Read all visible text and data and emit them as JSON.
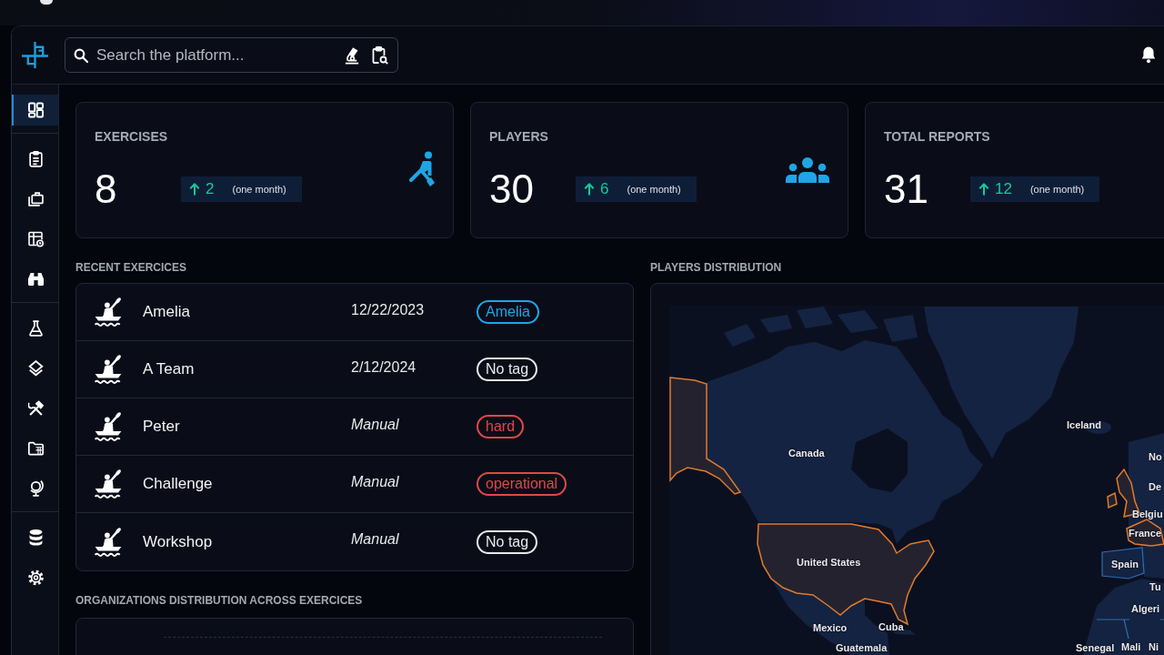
{
  "top_bar": {
    "search": {
      "placeholder": "Search the platform..."
    }
  },
  "sidebar": {
    "sections": [
      {
        "items": [
          {
            "selected": true
          }
        ]
      },
      {
        "items": [
          {
            "selected": false
          },
          {
            "selected": false
          },
          {
            "selected": false
          },
          {
            "selected": false
          }
        ]
      },
      {
        "items": [
          {
            "selected": false
          },
          {
            "selected": false
          },
          {
            "selected": false
          },
          {
            "selected": false
          },
          {
            "selected": false
          }
        ]
      },
      {
        "items": [
          {
            "selected": false
          },
          {
            "selected": false
          }
        ]
      }
    ]
  },
  "stats": [
    {
      "label": "EXERCISES",
      "value": "8",
      "change": "2",
      "period": "(one month)"
    },
    {
      "label": "PLAYERS",
      "value": "30",
      "change": "6",
      "period": "(one month)"
    },
    {
      "label": "TOTAL REPORTS",
      "value": "31",
      "change": "12",
      "period": "(one month)"
    }
  ],
  "recent_exercises": {
    "title": "RECENT EXERCICES",
    "rows": [
      {
        "name": "Amelia",
        "start": {
          "kind": "date",
          "text": "12/22/2023"
        },
        "tag": {
          "label": "Amelia",
          "color": "#1fa5e6"
        }
      },
      {
        "name": "A Team",
        "start": {
          "kind": "date",
          "text": "2/12/2024"
        },
        "tag": {
          "label": "No tag",
          "color": "#e8e8ec"
        }
      },
      {
        "name": "Peter",
        "start": {
          "kind": "manual",
          "text": "Manual"
        },
        "tag": {
          "label": "hard",
          "color": "#e04848"
        }
      },
      {
        "name": "Challenge",
        "start": {
          "kind": "manual",
          "text": "Manual"
        },
        "tag": {
          "label": "operational",
          "color": "#e04848"
        }
      },
      {
        "name": "Workshop",
        "start": {
          "kind": "manual",
          "text": "Manual"
        },
        "tag": {
          "label": "No tag",
          "color": "#e8e8ec"
        }
      }
    ]
  },
  "players_distribution": {
    "title": "PLAYERS DISTRIBUTION",
    "map_labels": [
      "Iceland",
      "Canada",
      "No",
      "De",
      "Belgiu",
      "France",
      "United States",
      "Spain",
      "Tu",
      "Algeri",
      "Mexico",
      "Cuba",
      "Guatemala",
      "Senegal",
      "Mali",
      "Ni"
    ]
  },
  "organizations_distribution": {
    "title": "ORGANIZATIONS DISTRIBUTION ACROSS EXERCICES"
  }
}
